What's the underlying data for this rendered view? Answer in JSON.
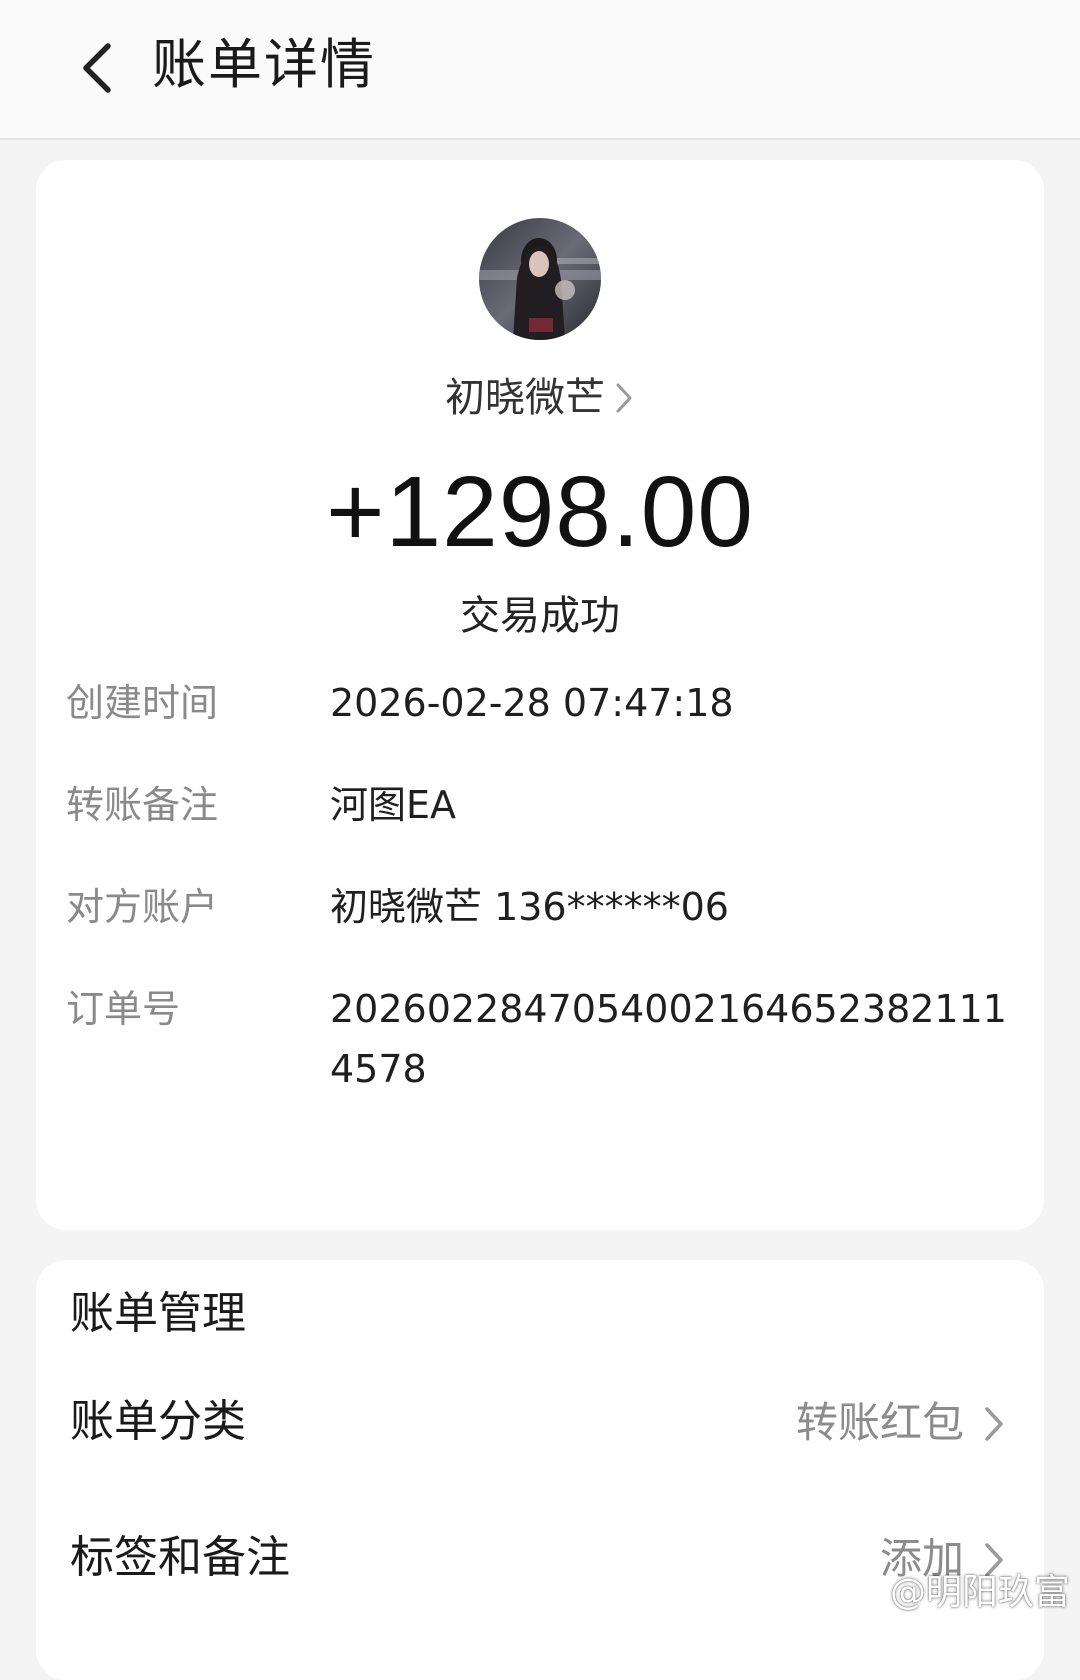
{
  "header": {
    "title": "账单详情"
  },
  "payer": {
    "name": "初晓微芒"
  },
  "transaction": {
    "amount": "+1298.00",
    "status": "交易成功"
  },
  "details": [
    {
      "label": "创建时间",
      "value": "2026-02-28 07:47:18"
    },
    {
      "label": "转账备注",
      "value": "河图EA"
    },
    {
      "label": "对方账户",
      "value": "初晓微芒 136******06"
    },
    {
      "label": "订单号",
      "value": "20260228470540021646523821114578"
    }
  ],
  "management": {
    "section_title": "账单管理",
    "category_label": "账单分类",
    "category_value": "转账红包",
    "tags_label": "标签和备注",
    "tags_value": "添加"
  },
  "watermark": {
    "text": "@明阳玖富"
  }
}
